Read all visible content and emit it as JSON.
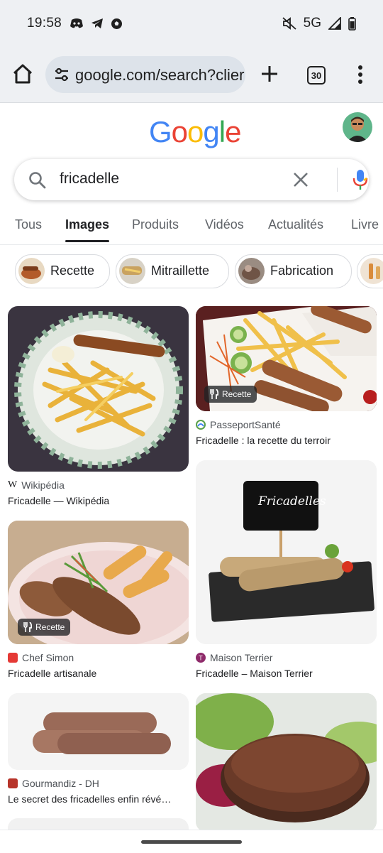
{
  "status_bar": {
    "time": "19:58",
    "network": "5G",
    "icons_left": [
      "discord-icon",
      "telegram-icon",
      "football-icon"
    ],
    "icons_right": [
      "mute-icon",
      "signal-icon",
      "battery-icon"
    ]
  },
  "browser": {
    "url": "google.com/search?clier",
    "tab_count": "30"
  },
  "google": {
    "logo_letters": [
      "G",
      "o",
      "o",
      "g",
      "l",
      "e"
    ],
    "logo_colors": [
      "#4285F4",
      "#EA4335",
      "#FBBC05",
      "#4285F4",
      "#34A853",
      "#EA4335"
    ]
  },
  "search": {
    "query": "fricadelle"
  },
  "tabs": [
    {
      "label": "Tous",
      "active": false
    },
    {
      "label": "Images",
      "active": true
    },
    {
      "label": "Produits",
      "active": false
    },
    {
      "label": "Vidéos",
      "active": false
    },
    {
      "label": "Actualités",
      "active": false
    },
    {
      "label": "Livre",
      "active": false
    }
  ],
  "chips": [
    {
      "label": "Recette"
    },
    {
      "label": "Mitraillette"
    },
    {
      "label": "Fabrication"
    }
  ],
  "results": [
    {
      "source": "Wikipédia",
      "title": "Fricadelle — Wikipédia",
      "badge": ""
    },
    {
      "source": "PasseportSanté",
      "title": "Fricadelle : la recette du terroir",
      "badge": "Recette"
    },
    {
      "source": "Chef Simon",
      "title": "Fricadelle artisanale",
      "badge": "Recette"
    },
    {
      "source": "Maison Terrier",
      "title": "Fricadelle – Maison Terrier",
      "badge": ""
    },
    {
      "source": "Gourmandiz - DH",
      "title": "Le secret des fricadelles enfin révé…",
      "badge": ""
    }
  ],
  "sign_text": "Fricadelles",
  "colors": {
    "accent_blue": "#4285F4",
    "chrome_bg": "#eef0f3",
    "url_bg": "#dde3ea"
  }
}
